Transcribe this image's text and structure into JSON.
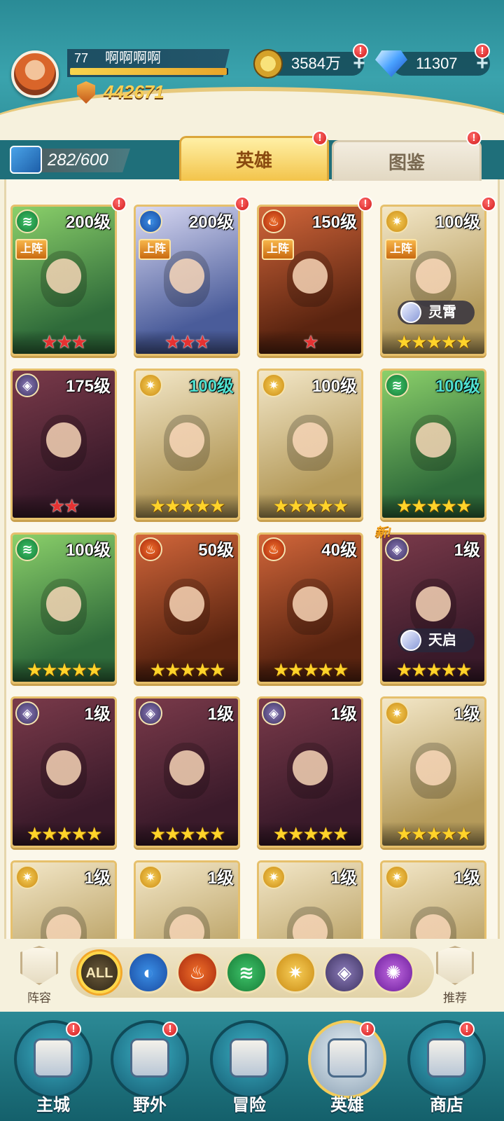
{
  "player": {
    "level": "77",
    "name": "啊啊啊啊",
    "exp_fraction": 0.99,
    "power": "442671"
  },
  "resources": {
    "gold": "3584万",
    "gems": "11307",
    "plus": "+"
  },
  "badge_mark": "!",
  "hero_count": "282/600",
  "tabs": {
    "heroes": "英雄",
    "atlas": "图鉴"
  },
  "deployed_label": "上阵",
  "new_label": "新!",
  "heroes": [
    {
      "level": "200级",
      "faction": "wind",
      "deployed": true,
      "star_type": "red",
      "stars": 3,
      "badge": true,
      "skin": ""
    },
    {
      "level": "200级",
      "faction": "water",
      "deployed": true,
      "star_type": "red",
      "stars": 3,
      "badge": true,
      "skin": ""
    },
    {
      "level": "150级",
      "faction": "fire",
      "deployed": true,
      "star_type": "red",
      "stars": 1,
      "badge": true,
      "skin": ""
    },
    {
      "level": "100级",
      "faction": "light",
      "deployed": true,
      "star_type": "gold",
      "stars": 5,
      "badge": true,
      "skin": "灵霄"
    },
    {
      "level": "175级",
      "faction": "dark",
      "deployed": false,
      "star_type": "red",
      "stars": 2,
      "badge": false,
      "skin": ""
    },
    {
      "level": "100级",
      "faction": "light",
      "deployed": false,
      "star_type": "gold",
      "stars": 5,
      "badge": false,
      "skin": "",
      "teal": true
    },
    {
      "level": "100级",
      "faction": "light",
      "deployed": false,
      "star_type": "gold",
      "stars": 5,
      "badge": false,
      "skin": ""
    },
    {
      "level": "100级",
      "faction": "wind",
      "deployed": false,
      "star_type": "gold",
      "stars": 5,
      "badge": false,
      "skin": "",
      "teal": true
    },
    {
      "level": "100级",
      "faction": "wind",
      "deployed": false,
      "star_type": "gold",
      "stars": 5,
      "badge": false,
      "skin": ""
    },
    {
      "level": "50级",
      "faction": "fire",
      "deployed": false,
      "star_type": "gold",
      "stars": 5,
      "badge": false,
      "skin": ""
    },
    {
      "level": "40级",
      "faction": "fire",
      "deployed": false,
      "star_type": "gold",
      "stars": 5,
      "badge": false,
      "skin": ""
    },
    {
      "level": "1级",
      "faction": "dark",
      "deployed": false,
      "star_type": "gold",
      "stars": 5,
      "badge": false,
      "skin": "天启",
      "new": true
    },
    {
      "level": "1级",
      "faction": "dark",
      "deployed": false,
      "star_type": "gold",
      "stars": 5,
      "badge": false,
      "skin": ""
    },
    {
      "level": "1级",
      "faction": "dark",
      "deployed": false,
      "star_type": "gold",
      "stars": 5,
      "badge": false,
      "skin": ""
    },
    {
      "level": "1级",
      "faction": "dark",
      "deployed": false,
      "star_type": "gold",
      "stars": 5,
      "badge": false,
      "skin": ""
    },
    {
      "level": "1级",
      "faction": "light",
      "deployed": false,
      "star_type": "gold",
      "stars": 5,
      "badge": false,
      "skin": ""
    },
    {
      "level": "1级",
      "faction": "light",
      "deployed": false,
      "star_type": "gold",
      "stars": 0,
      "badge": false,
      "skin": ""
    },
    {
      "level": "1级",
      "faction": "light",
      "deployed": false,
      "star_type": "gold",
      "stars": 0,
      "badge": false,
      "skin": ""
    },
    {
      "level": "1级",
      "faction": "light",
      "deployed": false,
      "star_type": "gold",
      "stars": 0,
      "badge": false,
      "skin": ""
    },
    {
      "level": "1级",
      "faction": "light",
      "deployed": false,
      "star_type": "gold",
      "stars": 0,
      "badge": false,
      "skin": ""
    }
  ],
  "filters": {
    "lineup_label": "阵容",
    "recommend_label": "推荐",
    "all_label": "ALL",
    "factions": [
      "water",
      "fire",
      "wind",
      "light",
      "dark",
      "void"
    ]
  },
  "nav": {
    "city": "主城",
    "wild": "野外",
    "adventure": "冒险",
    "heroes": "英雄",
    "shop": "商店"
  }
}
